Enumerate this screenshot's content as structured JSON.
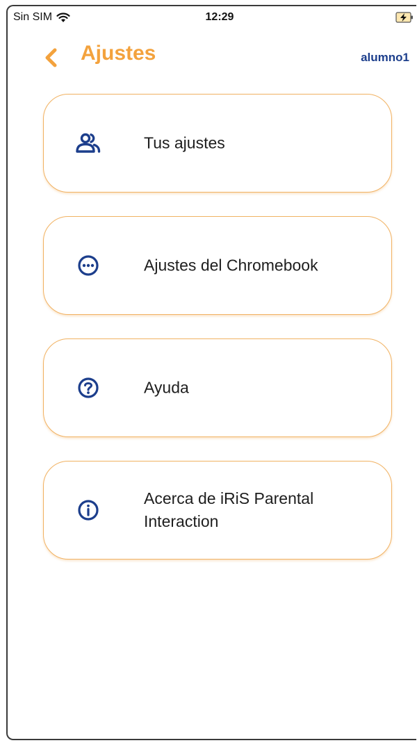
{
  "status_bar": {
    "carrier": "Sin SIM",
    "time": "12:29"
  },
  "header": {
    "title": "Ajustes",
    "user": "alumno1"
  },
  "menu": {
    "items": [
      {
        "label": "Tus ajustes",
        "icon": "users-icon"
      },
      {
        "label": "Ajustes del Chromebook",
        "icon": "more-horizontal-circle-icon"
      },
      {
        "label": "Ayuda",
        "icon": "help-circle-icon"
      },
      {
        "label": "Acerca de iRiS Parental Interaction",
        "icon": "info-circle-icon"
      }
    ]
  },
  "colors": {
    "accent": "#f3a23d",
    "card_border": "#f1b263",
    "icon": "#1c3e8c",
    "text": "#1e1e1e"
  }
}
